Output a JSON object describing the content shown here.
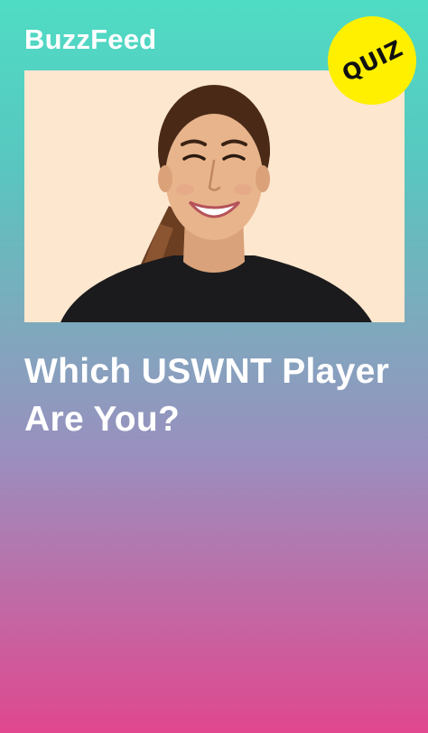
{
  "pin": {
    "brand": "BuzzFeed",
    "badge": "QUIZ",
    "title": "Which USWNT Player Are You?",
    "photo_subject": "smiling-woman-with-ponytail"
  },
  "colors": {
    "gradient_top": "#4fdcc4",
    "gradient_middle": "#9a8fbf",
    "gradient_bottom": "#e0478f",
    "photo_background": "#fde7cf",
    "badge_background": "#fff000",
    "text": "#ffffff"
  }
}
